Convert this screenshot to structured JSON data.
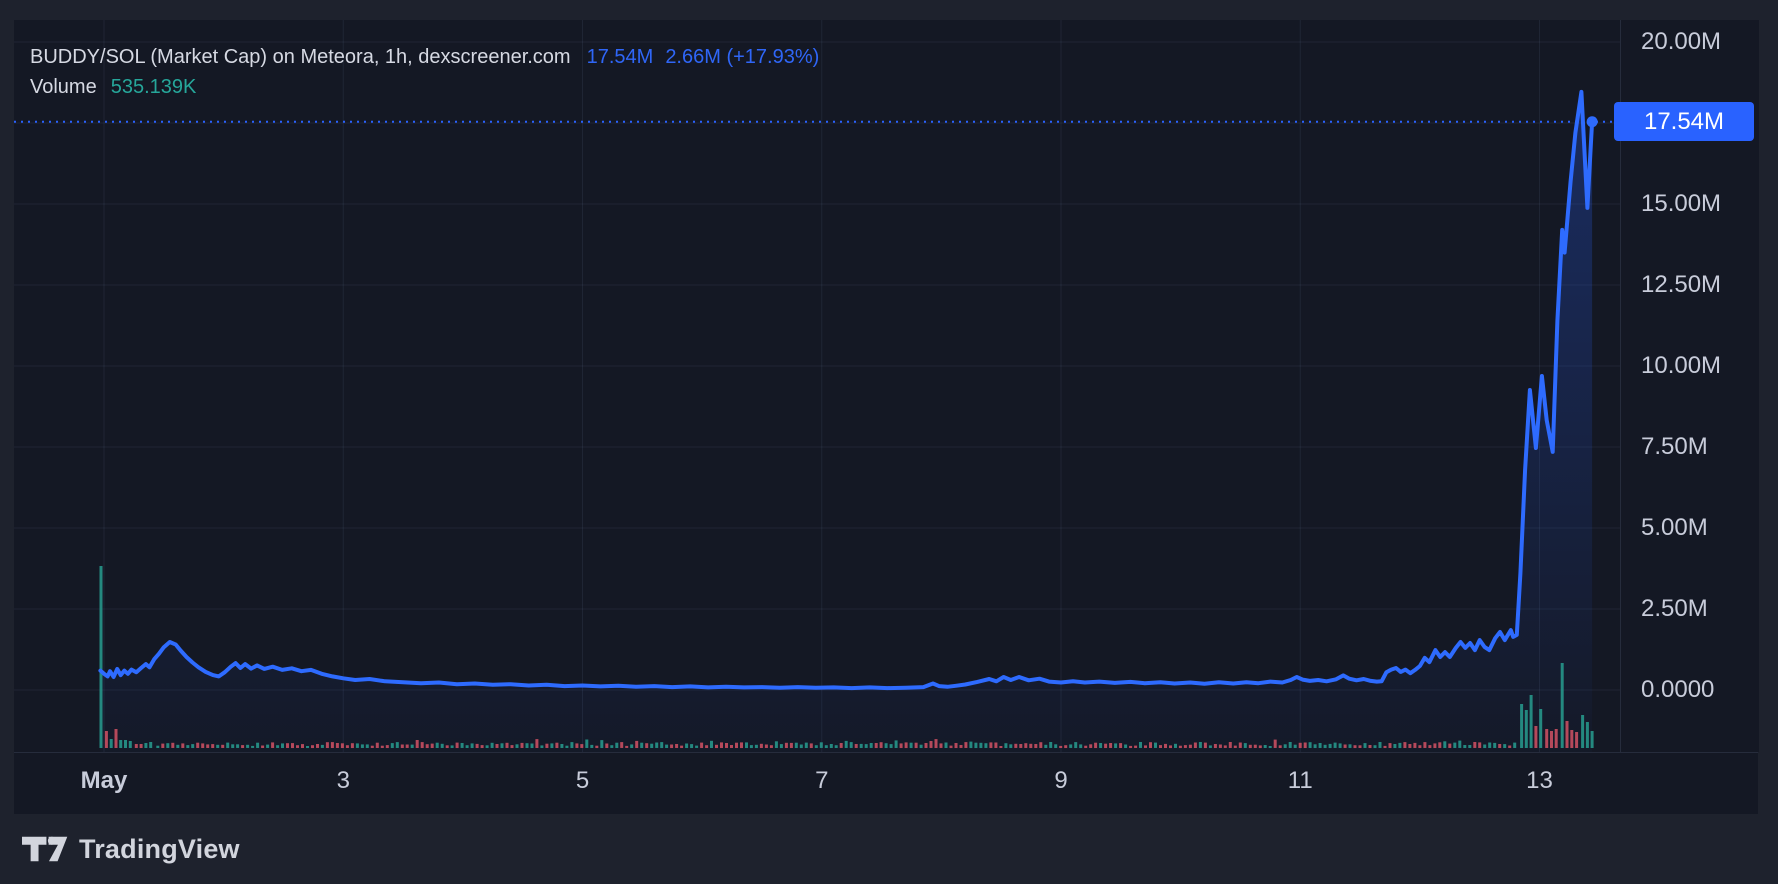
{
  "header": {
    "symbol_line": "BUDDY/SOL (Market Cap) on Meteora, 1h, dexscreener.com",
    "price": "17.54M",
    "change": "2.66M (+17.93%)",
    "volume_label": "Volume",
    "volume_value": "535.139K"
  },
  "price_badge": {
    "text": "17.54M"
  },
  "footer": {
    "brand": "TradingView"
  },
  "colors": {
    "accent_blue": "#2962ff",
    "line_blue": "#2e6bfe",
    "area_blue": "41,98,255",
    "volume_up": "#27998c",
    "volume_down": "#cc5062",
    "header_blue": "#2f66f7",
    "volume_value_green": "#26a69a",
    "grid": "rgba(140,160,200,0.10)",
    "axis_text": "#c8ccda",
    "chart_bg": "#141824",
    "page_bg": "#1e222d"
  },
  "chart_data": {
    "type": "line",
    "title": "BUDDY/SOL Market Cap, 1h",
    "xlabel": "Date (May)",
    "ylabel": "Market Cap",
    "ylim_M": [
      -1.9,
      20.7
    ],
    "grid": true,
    "x_axis": {
      "ticks": [
        {
          "label": "May",
          "day": 1,
          "bold": true
        },
        {
          "label": "3",
          "day": 3,
          "bold": false
        },
        {
          "label": "5",
          "day": 5,
          "bold": false
        },
        {
          "label": "7",
          "day": 7,
          "bold": false
        },
        {
          "label": "9",
          "day": 9,
          "bold": false
        },
        {
          "label": "11",
          "day": 11,
          "bold": false
        },
        {
          "label": "13",
          "day": 13,
          "bold": false
        }
      ]
    },
    "y_axis": {
      "ticks": [
        {
          "label": "20.00M",
          "v": 20
        },
        {
          "label": "15.00M",
          "v": 15
        },
        {
          "label": "12.50M",
          "v": 12.5
        },
        {
          "label": "10.00M",
          "v": 10
        },
        {
          "label": "7.50M",
          "v": 7.5
        },
        {
          "label": "5.00M",
          "v": 5
        },
        {
          "label": "2.50M",
          "v": 2.5
        },
        {
          "label": "0.0000",
          "v": 0
        }
      ]
    },
    "current": {
      "value_M": 17.54,
      "day": 13.44,
      "label": "17.54M"
    },
    "series": [
      [
        0.97,
        0.6
      ],
      [
        1.0,
        0.5
      ],
      [
        1.03,
        0.42
      ],
      [
        1.05,
        0.58
      ],
      [
        1.08,
        0.4
      ],
      [
        1.11,
        0.65
      ],
      [
        1.14,
        0.46
      ],
      [
        1.17,
        0.6
      ],
      [
        1.2,
        0.5
      ],
      [
        1.23,
        0.63
      ],
      [
        1.27,
        0.55
      ],
      [
        1.31,
        0.68
      ],
      [
        1.35,
        0.8
      ],
      [
        1.38,
        0.7
      ],
      [
        1.42,
        0.95
      ],
      [
        1.46,
        1.12
      ],
      [
        1.5,
        1.32
      ],
      [
        1.55,
        1.48
      ],
      [
        1.6,
        1.4
      ],
      [
        1.64,
        1.22
      ],
      [
        1.69,
        1.02
      ],
      [
        1.74,
        0.85
      ],
      [
        1.79,
        0.7
      ],
      [
        1.85,
        0.56
      ],
      [
        1.91,
        0.46
      ],
      [
        1.96,
        0.42
      ],
      [
        2.01,
        0.55
      ],
      [
        2.06,
        0.72
      ],
      [
        2.1,
        0.83
      ],
      [
        2.14,
        0.68
      ],
      [
        2.18,
        0.8
      ],
      [
        2.23,
        0.66
      ],
      [
        2.28,
        0.76
      ],
      [
        2.34,
        0.65
      ],
      [
        2.41,
        0.72
      ],
      [
        2.49,
        0.62
      ],
      [
        2.57,
        0.67
      ],
      [
        2.65,
        0.58
      ],
      [
        2.73,
        0.62
      ],
      [
        2.82,
        0.5
      ],
      [
        2.91,
        0.42
      ],
      [
        3.0,
        0.36
      ],
      [
        3.1,
        0.31
      ],
      [
        3.22,
        0.34
      ],
      [
        3.35,
        0.27
      ],
      [
        3.5,
        0.24
      ],
      [
        3.65,
        0.21
      ],
      [
        3.8,
        0.23
      ],
      [
        3.95,
        0.18
      ],
      [
        4.1,
        0.2
      ],
      [
        4.25,
        0.16
      ],
      [
        4.4,
        0.18
      ],
      [
        4.55,
        0.14
      ],
      [
        4.7,
        0.16
      ],
      [
        4.85,
        0.12
      ],
      [
        5.0,
        0.14
      ],
      [
        5.15,
        0.11
      ],
      [
        5.3,
        0.13
      ],
      [
        5.45,
        0.1
      ],
      [
        5.6,
        0.12
      ],
      [
        5.75,
        0.09
      ],
      [
        5.9,
        0.11
      ],
      [
        6.05,
        0.08
      ],
      [
        6.2,
        0.1
      ],
      [
        6.35,
        0.08
      ],
      [
        6.5,
        0.09
      ],
      [
        6.65,
        0.07
      ],
      [
        6.8,
        0.09
      ],
      [
        6.95,
        0.07
      ],
      [
        7.1,
        0.08
      ],
      [
        7.25,
        0.06
      ],
      [
        7.4,
        0.08
      ],
      [
        7.55,
        0.06
      ],
      [
        7.7,
        0.07
      ],
      [
        7.85,
        0.09
      ],
      [
        7.93,
        0.2
      ],
      [
        7.98,
        0.12
      ],
      [
        8.05,
        0.1
      ],
      [
        8.12,
        0.13
      ],
      [
        8.2,
        0.17
      ],
      [
        8.3,
        0.25
      ],
      [
        8.4,
        0.34
      ],
      [
        8.46,
        0.27
      ],
      [
        8.52,
        0.4
      ],
      [
        8.58,
        0.31
      ],
      [
        8.65,
        0.4
      ],
      [
        8.73,
        0.3
      ],
      [
        8.82,
        0.35
      ],
      [
        8.9,
        0.26
      ],
      [
        9.0,
        0.23
      ],
      [
        9.1,
        0.27
      ],
      [
        9.2,
        0.23
      ],
      [
        9.32,
        0.26
      ],
      [
        9.45,
        0.22
      ],
      [
        9.58,
        0.25
      ],
      [
        9.7,
        0.21
      ],
      [
        9.83,
        0.24
      ],
      [
        9.95,
        0.2
      ],
      [
        10.08,
        0.23
      ],
      [
        10.2,
        0.19
      ],
      [
        10.32,
        0.24
      ],
      [
        10.44,
        0.2
      ],
      [
        10.55,
        0.24
      ],
      [
        10.65,
        0.21
      ],
      [
        10.75,
        0.26
      ],
      [
        10.85,
        0.23
      ],
      [
        10.92,
        0.31
      ],
      [
        10.97,
        0.4
      ],
      [
        11.02,
        0.32
      ],
      [
        11.08,
        0.28
      ],
      [
        11.15,
        0.31
      ],
      [
        11.22,
        0.27
      ],
      [
        11.3,
        0.33
      ],
      [
        11.36,
        0.45
      ],
      [
        11.41,
        0.35
      ],
      [
        11.47,
        0.3
      ],
      [
        11.53,
        0.34
      ],
      [
        11.59,
        0.28
      ],
      [
        11.64,
        0.26
      ],
      [
        11.68,
        0.27
      ],
      [
        11.72,
        0.55
      ],
      [
        11.76,
        0.63
      ],
      [
        11.8,
        0.68
      ],
      [
        11.84,
        0.56
      ],
      [
        11.88,
        0.63
      ],
      [
        11.92,
        0.52
      ],
      [
        11.96,
        0.62
      ],
      [
        12.0,
        0.74
      ],
      [
        12.04,
        0.99
      ],
      [
        12.08,
        0.86
      ],
      [
        12.13,
        1.23
      ],
      [
        12.17,
        1.02
      ],
      [
        12.21,
        1.17
      ],
      [
        12.25,
        1.02
      ],
      [
        12.3,
        1.3
      ],
      [
        12.34,
        1.48
      ],
      [
        12.38,
        1.3
      ],
      [
        12.42,
        1.45
      ],
      [
        12.46,
        1.23
      ],
      [
        12.5,
        1.54
      ],
      [
        12.54,
        1.33
      ],
      [
        12.58,
        1.23
      ],
      [
        12.63,
        1.6
      ],
      [
        12.67,
        1.79
      ],
      [
        12.71,
        1.54
      ],
      [
        12.76,
        1.85
      ],
      [
        12.78,
        1.64
      ],
      [
        12.81,
        1.7
      ],
      [
        12.84,
        3.6
      ],
      [
        12.88,
        6.8
      ],
      [
        12.92,
        9.26
      ],
      [
        12.97,
        7.47
      ],
      [
        13.02,
        9.69
      ],
      [
        13.06,
        8.33
      ],
      [
        13.11,
        7.35
      ],
      [
        13.15,
        11.4
      ],
      [
        13.19,
        14.2
      ],
      [
        13.21,
        13.5
      ],
      [
        13.26,
        15.7
      ],
      [
        13.3,
        17.2
      ],
      [
        13.35,
        18.46
      ],
      [
        13.4,
        14.88
      ],
      [
        13.44,
        17.54
      ]
    ],
    "volume": {
      "note": "no volume scale shown; heights are as-depicted pixels",
      "notable": [
        [
          0.975,
          182,
          "up"
        ],
        [
          1.02,
          17,
          "down"
        ],
        [
          1.06,
          9,
          "up"
        ],
        [
          1.1,
          19,
          "down"
        ],
        [
          1.14,
          8,
          "up"
        ],
        [
          1.18,
          8,
          "up"
        ],
        [
          1.22,
          7,
          "up"
        ],
        [
          1.27,
          4,
          "down"
        ],
        [
          1.31,
          4,
          "down"
        ],
        [
          1.35,
          5,
          "up"
        ],
        [
          1.39,
          6,
          "up"
        ],
        [
          12.85,
          44,
          "up"
        ],
        [
          12.89,
          38,
          "up"
        ],
        [
          12.93,
          53,
          "up"
        ],
        [
          12.97,
          22,
          "down"
        ],
        [
          13.01,
          39,
          "up"
        ],
        [
          13.06,
          19,
          "down"
        ],
        [
          13.1,
          17,
          "down"
        ],
        [
          13.14,
          19,
          "down"
        ],
        [
          13.19,
          85,
          "up"
        ],
        [
          13.23,
          27,
          "down"
        ],
        [
          13.27,
          18,
          "down"
        ],
        [
          13.31,
          16,
          "down"
        ],
        [
          13.36,
          33,
          "up"
        ],
        [
          13.4,
          26,
          "up"
        ],
        [
          13.44,
          17,
          "up"
        ]
      ],
      "noise": {
        "from_day": 1.45,
        "to_day": 12.8,
        "step_days": 0.0417,
        "min_h": 2,
        "max_h": 6,
        "seed": 97
      }
    }
  }
}
